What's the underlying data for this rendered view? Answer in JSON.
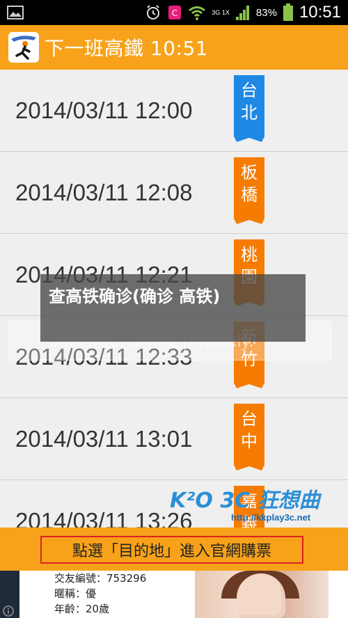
{
  "status_bar": {
    "network_label": "3G 1X",
    "battery_percent": "83%",
    "time": "10:51"
  },
  "app": {
    "title": "下一班高鐵 10:51"
  },
  "trains": [
    {
      "time": "2014/03/11 12:00",
      "station": "台北",
      "tag_color": "#1e88e5"
    },
    {
      "time": "2014/03/11 12:08",
      "station": "板橋",
      "tag_color": "#f57c00"
    },
    {
      "time": "2014/03/11 12:21",
      "station": "桃園",
      "tag_color": "#f57c00"
    },
    {
      "time": "2014/03/11 12:33",
      "station": "新竹",
      "tag_color": "#f57c00"
    },
    {
      "time": "2014/03/11 13:01",
      "station": "台中",
      "tag_color": "#f57c00"
    },
    {
      "time": "2014/03/11 13:26",
      "station": "嘉義",
      "tag_color": "#f57c00"
    }
  ],
  "overlay": {
    "watermark_text": "查高铁确诊(确诊 高铁)",
    "faint_banner_text": "Join free. Share privately."
  },
  "brand": {
    "name": "K²O 3C 狂想曲",
    "url": "http://kkplay3c.net"
  },
  "buy_button": {
    "label": "點選「目的地」進入官網購票"
  },
  "ad": {
    "lines": [
      "交友編號：753296",
      "暱稱：優",
      "年齡：20歲"
    ]
  },
  "colors": {
    "accent": "#f7a21a",
    "status_bar": "#000000",
    "station_blue": "#1e88e5",
    "station_orange": "#f57c00",
    "buy_border": "#e02020"
  }
}
